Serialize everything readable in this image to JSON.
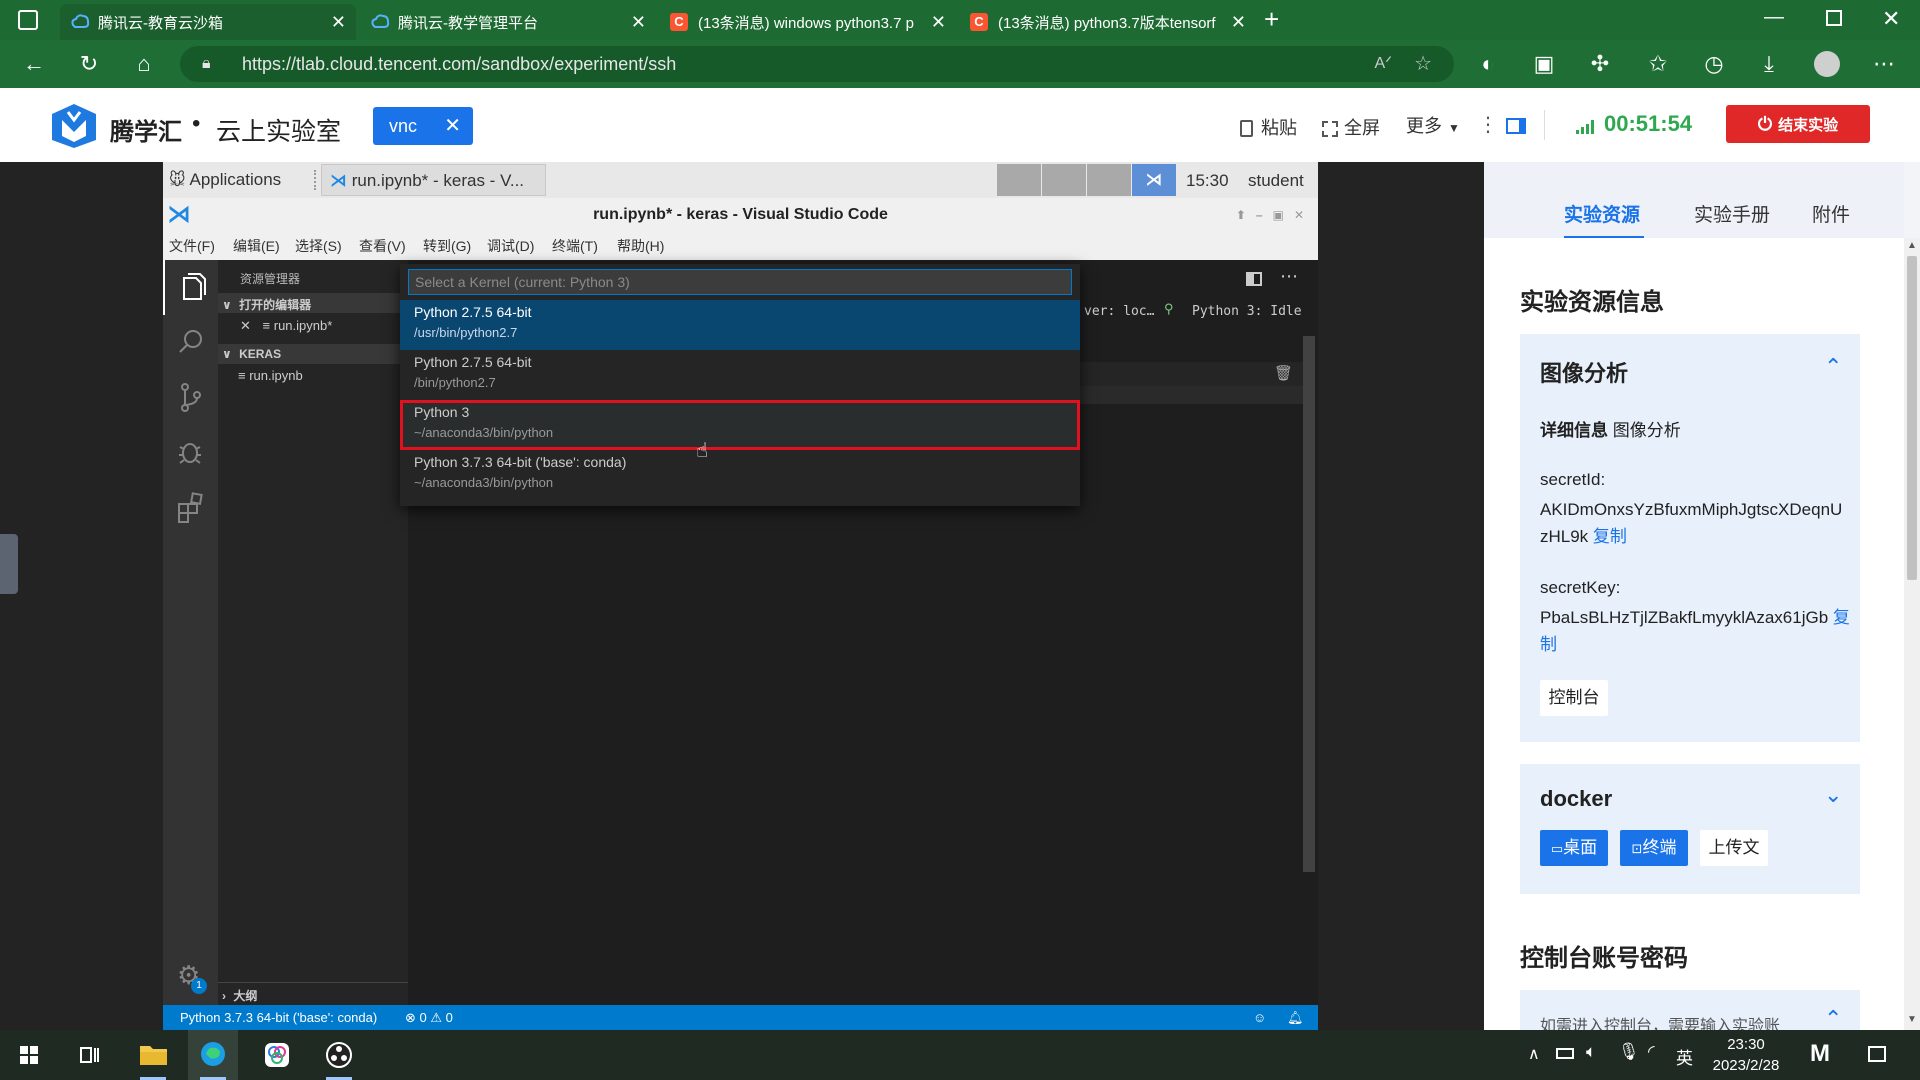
{
  "browser": {
    "tabs": [
      {
        "title": "腾讯云-教育云沙箱",
        "active": true
      },
      {
        "title": "腾讯云-教学管理平台",
        "active": false
      },
      {
        "title": "(13条消息) windows python3.7 p",
        "active": false
      },
      {
        "title": "(13条消息) python3.7版本tensorf",
        "active": false
      }
    ],
    "url": "https://tlab.cloud.tencent.com/sandbox/experiment/ssh"
  },
  "header": {
    "brand": "腾学汇",
    "separator": "•",
    "lab_title": "云上实验室",
    "session_tab": "vnc",
    "paste": "粘贴",
    "fullscreen": "全屏",
    "more": "更多",
    "timer": "00:51:54",
    "end_button": "结束实验"
  },
  "remote_panel": {
    "applications": "Applications",
    "task": "run.ipynb* - keras - V...",
    "clock": "15:30",
    "user": "student"
  },
  "vscode": {
    "title": "run.ipynb* - keras - Visual Studio Code",
    "menu": [
      "文件(F)",
      "编辑(E)",
      "选择(S)",
      "查看(V)",
      "转到(G)",
      "调试(D)",
      "终端(T)",
      "帮助(H)"
    ],
    "explorer_title": "资源管理器",
    "open_editors": "打开的编辑器",
    "open_file": "run.ipynb*",
    "folder": "KERAS",
    "folder_file": "run.ipynb",
    "outline": "大纲",
    "kernel_status": "ver: loc…",
    "kernel_idle": "Python 3: Idle",
    "settings_badge": "1",
    "picker": {
      "placeholder": "Select a Kernel (current: Python 3)",
      "items": [
        {
          "name": "Python 2.7.5 64-bit",
          "path": "/usr/bin/python2.7"
        },
        {
          "name": "Python 2.7.5 64-bit",
          "path": "/bin/python2.7"
        },
        {
          "name": "Python 3",
          "path": "~/anaconda3/bin/python"
        },
        {
          "name": "Python 3.7.3 64-bit ('base': conda)",
          "path": "~/anaconda3/bin/python"
        }
      ]
    },
    "status": {
      "interpreter": "Python 3.7.3 64-bit ('base': conda)",
      "errors": "0",
      "warnings": "0"
    }
  },
  "right_panel": {
    "tabs": [
      "实验资源",
      "实验手册",
      "附件"
    ],
    "section_title": "实验资源信息",
    "card1": {
      "title": "图像分析",
      "detail_label": "详细信息",
      "detail_value": "图像分析",
      "secret_id_label": "secretId:",
      "secret_id": "AKIDmOnxsYzBfuxmMiphJgtscXDeqnUzHL9k",
      "copy": "复制",
      "secret_key_label": "secretKey:",
      "secret_key": "PbaLsBLHzTjlZBakfLmyyklAzax61jGb",
      "console": "控制台"
    },
    "card2": {
      "title": "docker",
      "desktop": "桌面",
      "terminal": "终端",
      "upload": "上传文"
    },
    "section2_title": "控制台账号密码",
    "hint": "如需进入控制台，需要输入实验账"
  },
  "taskbar": {
    "time": "23:30",
    "date": "2023/2/28",
    "ime": "英"
  }
}
